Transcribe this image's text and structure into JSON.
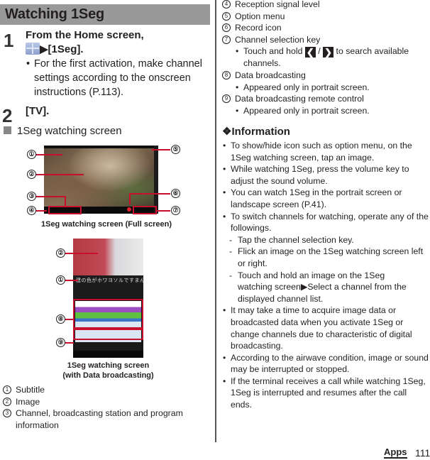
{
  "section_title": "Watching 1Seg",
  "steps": [
    {
      "number": "1",
      "line1": "From the Home screen,",
      "line2_icon": "apps-grid-icon",
      "line2_arrow": "▶",
      "line2_text": "[1Seg].",
      "note": "For the first activation, make channel settings according to the onscreen instructions (P.113)."
    },
    {
      "number": "2",
      "line1": "[TV]."
    }
  ],
  "subsection_title": "1Seg watching screen",
  "figures": [
    {
      "caption": "1Seg watching screen (Full screen)",
      "callouts": [
        "①",
        "②",
        "③",
        "④",
        "⑤",
        "⑥",
        "⑦"
      ]
    },
    {
      "caption_line1": "1Seg watching screen",
      "caption_line2": "(with Data broadcasting)",
      "subtitle_text": "建の色がホワヨソルですまん",
      "callouts": [
        "②",
        "①",
        "⑧",
        "⑨"
      ]
    }
  ],
  "legend": [
    {
      "num": "1",
      "text": "Subtitle"
    },
    {
      "num": "2",
      "text": "Image"
    },
    {
      "num": "3",
      "text": "Channel, broadcasting station and program information"
    },
    {
      "num": "4",
      "text": "Reception signal level"
    },
    {
      "num": "5",
      "text": "Option menu"
    },
    {
      "num": "6",
      "text": "Record icon"
    },
    {
      "num": "7",
      "text": "Channel selection key",
      "note_prefix": "Touch and hold",
      "key_left": "❮",
      "separator": "/",
      "key_right": "❯",
      "note_suffix": "to search available channels."
    },
    {
      "num": "8",
      "text": "Data broadcasting",
      "note": "Appeared only in portrait screen."
    },
    {
      "num": "9",
      "text": "Data broadcasting remote control",
      "note": "Appeared only in portrait screen."
    }
  ],
  "information": {
    "icon": "❖",
    "title": "Information",
    "bullets": [
      "To show/hide icon such as option menu, on the 1Seg watching screen, tap an image.",
      "While watching 1Seg, press the volume key to adjust the sound volume.",
      "You can watch 1Seg in the portrait screen or landscape screen (P.41).",
      "To switch channels for watching, operate any of the followings."
    ],
    "sub_items": [
      "Tap the channel selection key.",
      "Flick an image on the 1Seg watching screen left or right.",
      "Touch and hold an image on the 1Seg watching screen▶Select a channel from the displayed channel list."
    ],
    "bullets_after": [
      "It may take a time to acquire image data or broadcasted data when you activate 1Seg or change channels due to characteristic of digital broadcasting.",
      "According to the airwave condition, image or sound may be interrupted or stopped.",
      "If the terminal receives a call while watching 1Seg, 1Seg is interrupted and resumes after the call ends."
    ]
  },
  "footer": {
    "section": "Apps",
    "page": "111"
  }
}
